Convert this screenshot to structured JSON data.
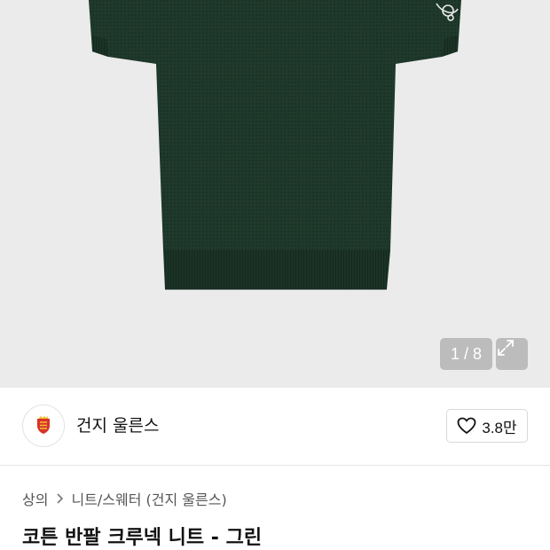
{
  "gallery": {
    "counter": "1 / 8",
    "background": "#ebebeb",
    "garment_color": "#1f3a2c"
  },
  "brand": {
    "name": "건지 울른스",
    "like_count": "3.8만"
  },
  "breadcrumb": {
    "items": [
      "상의",
      "니트/스웨터 (건지 울른스)"
    ]
  },
  "product": {
    "title": "코튼 반팔 크루넥 니트 - 그린"
  }
}
